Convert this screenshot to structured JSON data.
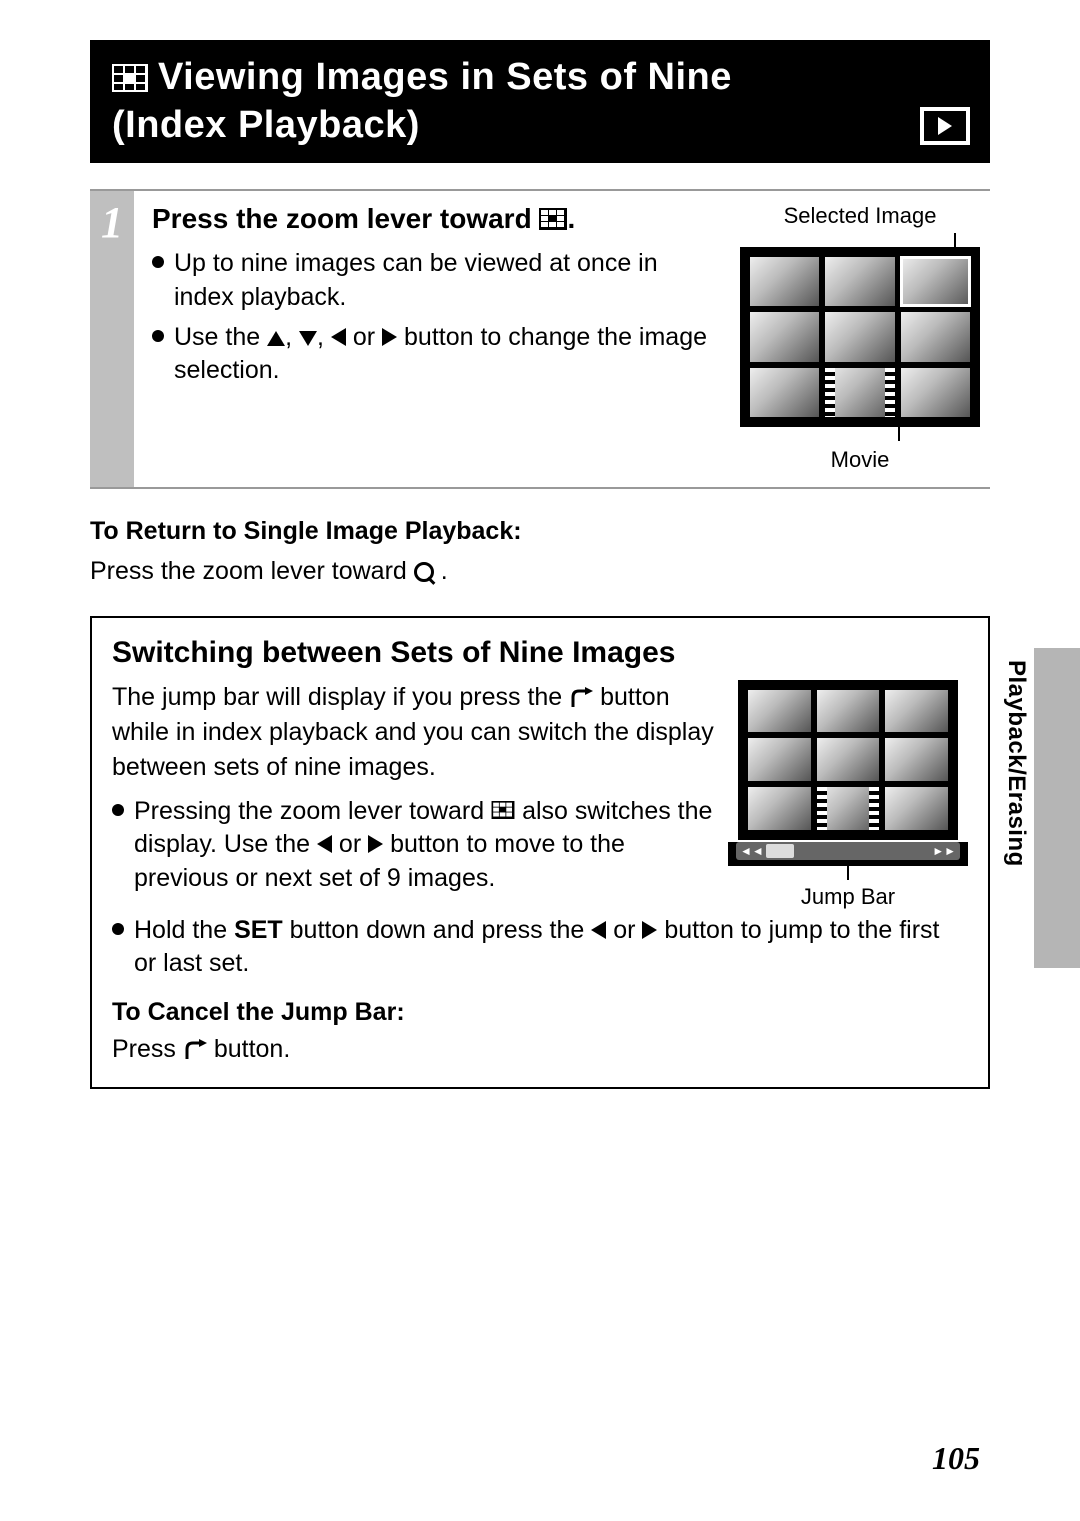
{
  "header": {
    "title_line1": "Viewing Images in Sets of Nine",
    "title_line2": "(Index Playback)"
  },
  "step1": {
    "number": "1",
    "heading_before": "Press the zoom lever toward ",
    "heading_after": ".",
    "bullets": {
      "b1": "Up to nine images can be viewed at once in index playback.",
      "b2_before": "Use the ",
      "b2_mid": " or ",
      "b2_after": " button to change the image selection."
    },
    "diagram": {
      "top_label": "Selected Image",
      "bottom_label": "Movie"
    }
  },
  "return_section": {
    "heading": "To Return to Single Image Playback:",
    "text_before": "Press the zoom lever toward ",
    "text_after": " ."
  },
  "box": {
    "title": "Switching between Sets of Nine Images",
    "para_before": "The jump bar will display if you press the ",
    "para_after": " button while in index playback and you can switch the display between sets of nine images.",
    "bullets": {
      "b1_before": "Pressing the zoom lever toward ",
      "b1_mid": " also switches the display. Use the ",
      "b1_mid2": " or ",
      "b1_after": " button to move to the previous or next set of 9 images.",
      "b2_before": "Hold the ",
      "b2_set": "SET",
      "b2_mid": " button down and press the ",
      "b2_mid2": " or ",
      "b2_after": " button to jump to the first or last set."
    },
    "diagram": {
      "label": "Jump Bar"
    },
    "cancel": {
      "heading": "To Cancel the Jump Bar:",
      "text_before": "Press ",
      "text_after": " button."
    }
  },
  "side_tab": "Playback/Erasing",
  "page_number": "105"
}
